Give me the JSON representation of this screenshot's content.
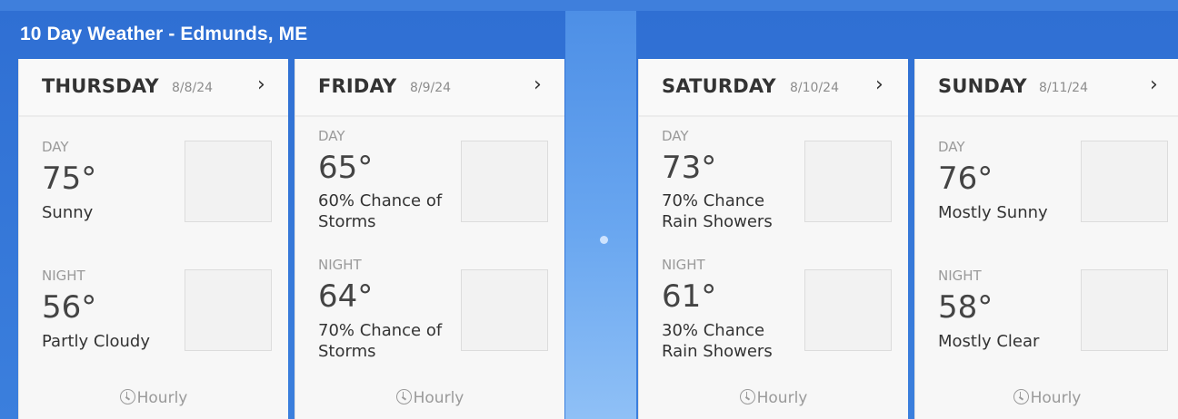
{
  "header": {
    "title": "10 Day Weather - Edmunds, ME"
  },
  "forecast": [
    {
      "day": "THURSDAY",
      "date": "8/8/24",
      "day_label": "DAY",
      "day_temp": "75°",
      "day_desc": [
        "Sunny"
      ],
      "night_label": "NIGHT",
      "night_temp": "56°",
      "night_desc": [
        "Partly Cloudy"
      ],
      "hourly": "Hourly"
    },
    {
      "day": "FRIDAY",
      "date": "8/9/24",
      "day_label": "DAY",
      "day_temp": "65°",
      "day_desc": [
        "60% Chance of",
        "Storms"
      ],
      "night_label": "NIGHT",
      "night_temp": "64°",
      "night_desc": [
        "70% Chance of",
        "Storms"
      ],
      "hourly": "Hourly"
    },
    {
      "day": "SATURDAY",
      "date": "8/10/24",
      "day_label": "DAY",
      "day_temp": "73°",
      "day_desc": [
        "70% Chance",
        "Rain Showers"
      ],
      "night_label": "NIGHT",
      "night_temp": "61°",
      "night_desc": [
        "30% Chance",
        "Rain Showers"
      ],
      "hourly": "Hourly"
    },
    {
      "day": "SUNDAY",
      "date": "8/11/24",
      "day_label": "DAY",
      "day_temp": "76°",
      "day_desc": [
        "Mostly Sunny"
      ],
      "night_label": "NIGHT",
      "night_temp": "58°",
      "night_desc": [
        "Mostly Clear"
      ],
      "hourly": "Hourly"
    }
  ],
  "icons": {
    "chevron": "chevron-right-icon",
    "clock": "clock-icon"
  },
  "colors": {
    "header_bg": "#2f6fd3",
    "card_bg": "#f7f7f7",
    "text": "#333333",
    "muted": "#9a9a9a"
  }
}
